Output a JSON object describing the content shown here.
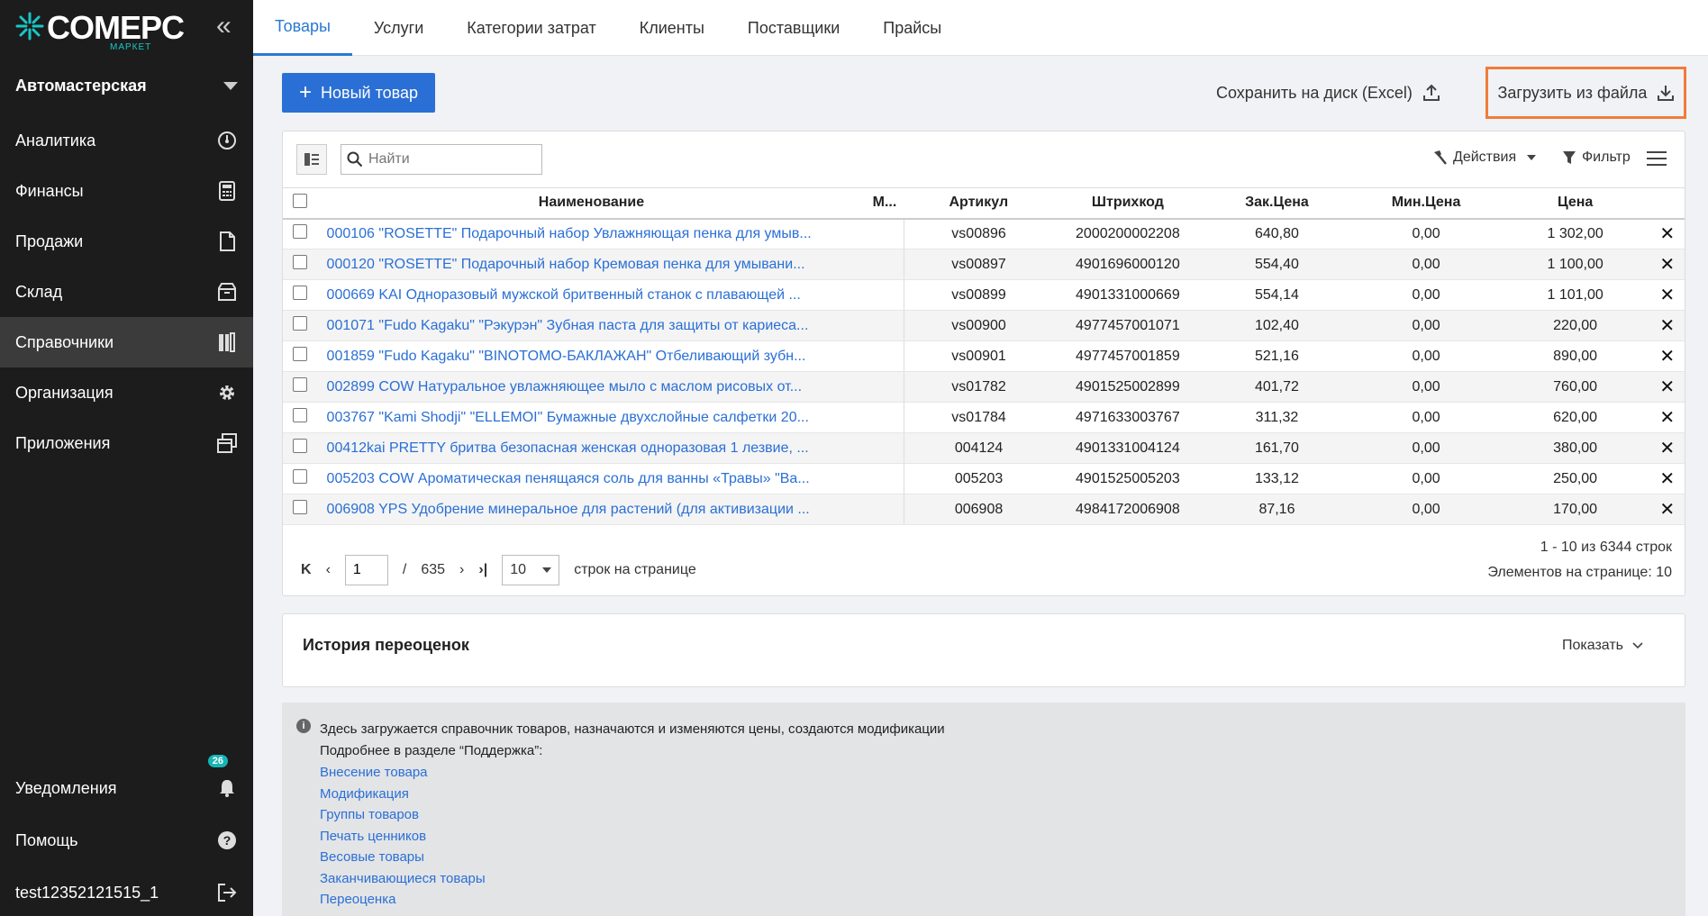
{
  "sidebar": {
    "logo_text": "COMEPC",
    "logo_sub": "МАРКЕТ",
    "org": "Автомастерская",
    "items": [
      {
        "label": "Аналитика",
        "icon": "speedometer-icon"
      },
      {
        "label": "Финансы",
        "icon": "calculator-icon"
      },
      {
        "label": "Продажи",
        "icon": "document-icon"
      },
      {
        "label": "Склад",
        "icon": "box-icon"
      },
      {
        "label": "Справочники",
        "icon": "books-icon",
        "active": true
      },
      {
        "label": "Организация",
        "icon": "gear-icon"
      },
      {
        "label": "Приложения",
        "icon": "windows-icon"
      }
    ],
    "bottom": {
      "notifications": "Уведомления",
      "notifications_count": "26",
      "help": "Помощь",
      "user": "test12352121515_1"
    }
  },
  "tabs": [
    "Товары",
    "Услуги",
    "Категории затрат",
    "Клиенты",
    "Поставщики",
    "Прайсы"
  ],
  "toolbar": {
    "new_label": "Новый товар",
    "save_label": "Сохранить на диск (Excel)",
    "load_label": "Загрузить из файла",
    "search_placeholder": "Найти",
    "actions_label": "Действия",
    "filter_label": "Фильтр"
  },
  "table": {
    "headers": {
      "name": "Наименование",
      "m": "М...",
      "article": "Артикул",
      "barcode": "Штрихкод",
      "buy_price": "Зак.Цена",
      "min_price": "Мин.Цена",
      "price": "Цена"
    },
    "rows": [
      {
        "name": "000106 \"ROSETTE\" Подарочный набор Увлажняющая пенка для умыв...",
        "article": "vs00896",
        "barcode": "2000200002208",
        "buy_price": "640,80",
        "min_price": "0,00",
        "price": "1 302,00"
      },
      {
        "name": "000120 \"ROSETTE\" Подарочный набор Кремовая пенка для умывани...",
        "article": "vs00897",
        "barcode": "4901696000120",
        "buy_price": "554,40",
        "min_price": "0,00",
        "price": "1 100,00"
      },
      {
        "name": "000669 KAI Одноразовый мужской бритвенный станок с плавающей ...",
        "article": "vs00899",
        "barcode": "4901331000669",
        "buy_price": "554,14",
        "min_price": "0,00",
        "price": "1 101,00"
      },
      {
        "name": "001071 \"Fudo Kagaku\" \"Рэкурэн\" Зубная паста для защиты от кариеса...",
        "article": "vs00900",
        "barcode": "4977457001071",
        "buy_price": "102,40",
        "min_price": "0,00",
        "price": "220,00"
      },
      {
        "name": "001859 \"Fudo Kagaku\" \"BINOTOMO-БАКЛАЖАН\" Отбеливающий зубн...",
        "article": "vs00901",
        "barcode": "4977457001859",
        "buy_price": "521,16",
        "min_price": "0,00",
        "price": "890,00"
      },
      {
        "name": "002899 COW Натуральное увлажняющее мыло с маслом рисовых от...",
        "article": "vs01782",
        "barcode": "4901525002899",
        "buy_price": "401,72",
        "min_price": "0,00",
        "price": "760,00"
      },
      {
        "name": "003767 \"Kami Shodji\" \"ELLEMOI\" Бумажные двухслойные салфетки 20...",
        "article": "vs01784",
        "barcode": "4971633003767",
        "buy_price": "311,32",
        "min_price": "0,00",
        "price": "620,00"
      },
      {
        "name": "00412kai PRETTY бритва безопасная женская одноразовая 1 лезвие, ...",
        "article": "004124",
        "barcode": "4901331004124",
        "buy_price": "161,70",
        "min_price": "0,00",
        "price": "380,00"
      },
      {
        "name": "005203 COW Ароматическая пенящаяся соль для ванны «Травы» \"Ва...",
        "article": "005203",
        "barcode": "4901525005203",
        "buy_price": "133,12",
        "min_price": "0,00",
        "price": "250,00"
      },
      {
        "name": "006908 YPS Удобрение минеральное для растений (для активизации ...",
        "article": "006908",
        "barcode": "4984172006908",
        "buy_price": "87,16",
        "min_price": "0,00",
        "price": "170,00"
      }
    ]
  },
  "pager": {
    "page": "1",
    "separator": "/",
    "total_pages": "635",
    "page_size": "10",
    "rows_label": "строк на странице",
    "range_text": "1 - 10 из 6344 строк",
    "per_page_text": "Элементов на странице: 10"
  },
  "history": {
    "title": "История переоценок",
    "show_label": "Показать"
  },
  "info": {
    "line1": "Здесь загружается справочник товаров, назначаются и изменяются цены, создаются модификации",
    "line2": "Подробнее в разделе “Поддержка”:",
    "links": [
      "Внесение товара",
      "Модификация",
      "Группы товаров",
      "Печать ценников",
      "Весовые товары",
      "Заканчивающиеся товары",
      "Переоценка"
    ]
  },
  "colors": {
    "accent": "#2a6fd6",
    "highlight": "#f07c3a",
    "sidebar_bg": "#1c1c1c",
    "badge": "#19b5b5"
  }
}
